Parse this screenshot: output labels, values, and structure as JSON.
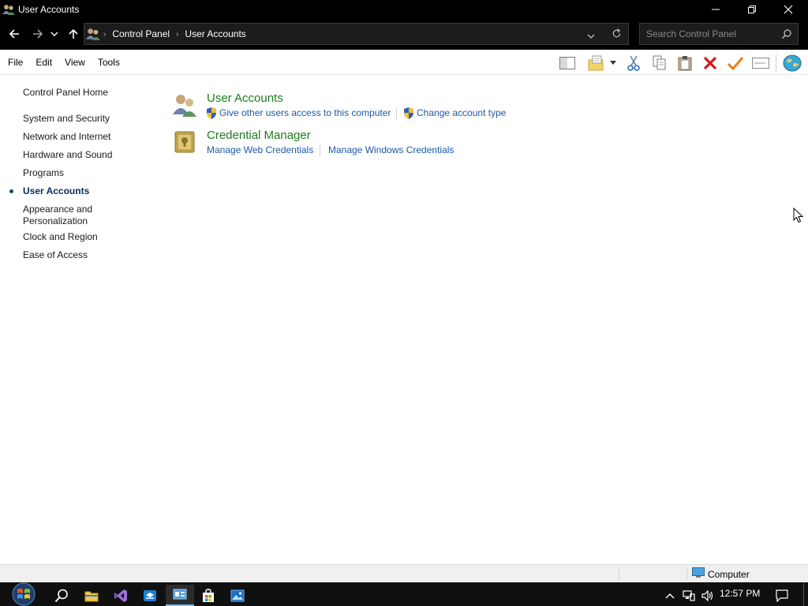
{
  "window": {
    "title": "User Accounts",
    "controls": [
      "minimize",
      "restore",
      "close"
    ]
  },
  "navigation": {
    "breadcrumb": [
      "Control Panel",
      "User Accounts"
    ],
    "search_placeholder": "Search Control Panel"
  },
  "menu": {
    "items": [
      "File",
      "Edit",
      "View",
      "Tools"
    ]
  },
  "toolbar": {
    "icons": [
      "preview-pane-icon",
      "new-folder-icon",
      "dropdown-arrow-icon",
      "cut-icon",
      "copy-icon",
      "paste-icon",
      "delete-icon",
      "checkmark-icon",
      "rename-icon",
      "globe-icon"
    ]
  },
  "sidebar": {
    "items": [
      {
        "label": "Control Panel Home"
      },
      {
        "label": "System and Security"
      },
      {
        "label": "Network and Internet"
      },
      {
        "label": "Hardware and Sound"
      },
      {
        "label": "Programs"
      },
      {
        "label": "User Accounts",
        "current": true
      },
      {
        "label": "Appearance and Personalization"
      },
      {
        "label": "Clock and Region"
      },
      {
        "label": "Ease of Access"
      }
    ]
  },
  "main": {
    "categories": [
      {
        "title": "User Accounts",
        "links": [
          "Give other users access to this computer",
          "Change account type"
        ]
      },
      {
        "title": "Credential Manager",
        "links": [
          "Manage Web Credentials",
          "Manage Windows Credentials"
        ]
      }
    ]
  },
  "statusbar": {
    "location": "Computer"
  },
  "taskbar": {
    "time": "12:57 PM"
  },
  "colors": {
    "category_title": "#1e7a1e",
    "link": "#1e5aa8",
    "titlebar": "#000000"
  }
}
